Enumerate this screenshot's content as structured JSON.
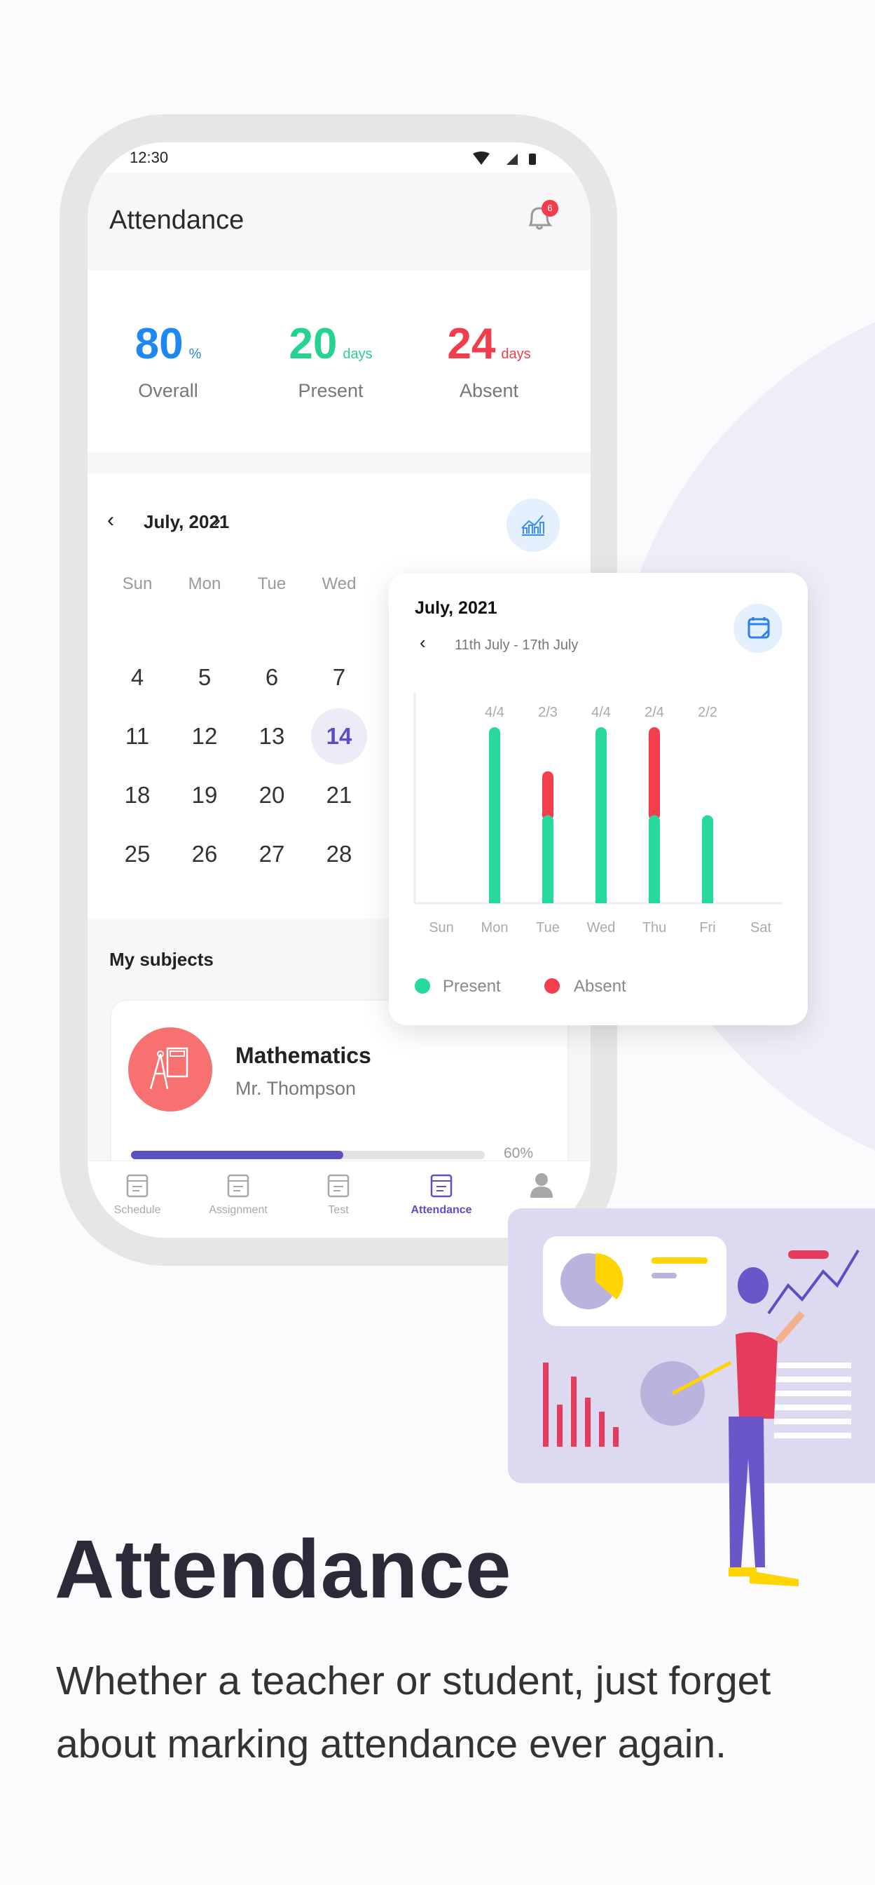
{
  "status_bar": {
    "time": "12:30"
  },
  "header": {
    "title": "Attendance",
    "notification_count": "6"
  },
  "stats": [
    {
      "value": "80",
      "unit": "%",
      "label": "Overall",
      "color": "#1e88f0"
    },
    {
      "value": "20",
      "unit": "days",
      "label": "Present",
      "color": "#27d28f"
    },
    {
      "value": "24",
      "unit": "days",
      "label": "Absent",
      "color": "#f23e4c"
    }
  ],
  "calendar": {
    "month": "July, 2021",
    "weekdays": [
      "Sun",
      "Mon",
      "Tue",
      "Wed"
    ],
    "rows": [
      [
        "4",
        "5",
        "6",
        "7"
      ],
      [
        "11",
        "12",
        "13",
        "14"
      ],
      [
        "18",
        "19",
        "20",
        "21"
      ],
      [
        "25",
        "26",
        "27",
        "28"
      ]
    ],
    "selected": "14"
  },
  "subjects": {
    "title": "My subjects",
    "items": [
      {
        "name": "Mathematics",
        "teacher": "Mr. Thompson",
        "progress": 60,
        "progress_label": "60%"
      }
    ]
  },
  "nav": [
    {
      "label": "Schedule",
      "icon": "calendar-clock-icon",
      "active": false
    },
    {
      "label": "Assignment",
      "icon": "clipboard-icon",
      "active": false
    },
    {
      "label": "Test",
      "icon": "test-sheet-icon",
      "active": false
    },
    {
      "label": "Attendance",
      "icon": "calendar-check-icon",
      "active": true
    },
    {
      "label": "",
      "icon": "profile-icon",
      "active": false
    }
  ],
  "popup": {
    "month": "July, 2021",
    "range": "11th July - 17th July"
  },
  "chart_data": {
    "type": "bar",
    "stacked": true,
    "categories": [
      "Sun",
      "Mon",
      "Tue",
      "Wed",
      "Thu",
      "Fri",
      "Sat"
    ],
    "series": [
      {
        "name": "Present",
        "color": "#27d99a",
        "values": [
          0,
          4,
          2,
          4,
          2,
          2,
          0
        ]
      },
      {
        "name": "Absent",
        "color": "#f43e4c",
        "values": [
          0,
          0,
          1,
          0,
          2,
          0,
          0
        ]
      }
    ],
    "data_labels": [
      "",
      "4/4",
      "2/3",
      "4/4",
      "2/4",
      "2/2",
      ""
    ],
    "ylim": [
      0,
      4
    ],
    "grid": false,
    "legend": "bottom-left"
  },
  "hero": {
    "title": "Attendance",
    "body": "Whether a teacher or student, just forget about marking attendance ever again."
  }
}
